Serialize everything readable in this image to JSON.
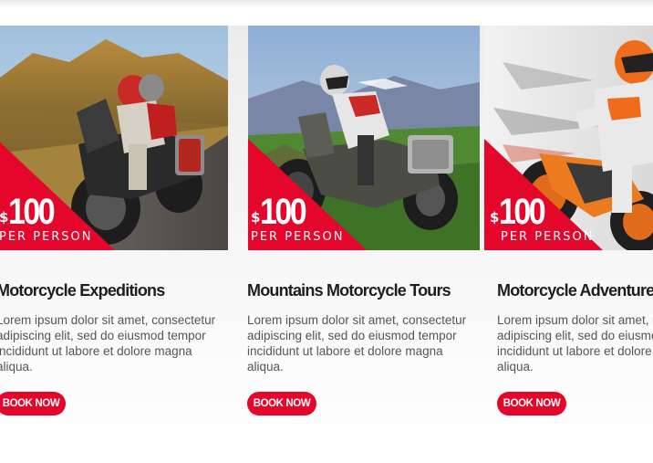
{
  "brand": {
    "accent": "#e4062b",
    "title_color": "#1e1e1e",
    "text_color": "#555555"
  },
  "tours": [
    {
      "image": "motorcycle-expedition-photo",
      "price_currency": "$",
      "price_amount": "100",
      "price_unit": "PER PERSON",
      "title": "Motorcycle Expeditions",
      "description": [
        "Lorem ipsum dolor sit amet, consectetur",
        "adipiscing elit, sed do eiusmod tempor",
        "incididunt ut labore et dolore magna",
        "aliqua."
      ],
      "button_label": "BOOK NOW"
    },
    {
      "image": "mountain-motorcycle-photo",
      "price_currency": "$",
      "price_amount": "100",
      "price_unit": "PER PERSON",
      "title": "Mountains Motorcycle Tours",
      "description": [
        "Lorem ipsum dolor sit amet, consectetur",
        "adipiscing elit, sed do eiusmod tempor",
        "incididunt ut labore et dolore magna",
        "aliqua."
      ],
      "button_label": "BOOK NOW"
    },
    {
      "image": "adventure-motorcycle-photo",
      "price_currency": "$",
      "price_amount": "100",
      "price_unit": "PER PERSON",
      "title": "Motorcycle Adventure Tours",
      "description": [
        "Lorem ipsum dolor sit amet, consectetur",
        "adipiscing elit, sed do eiusmod tempor",
        "incididunt ut labore et dolore magna",
        "aliqua."
      ],
      "button_label": "BOOK NOW"
    }
  ]
}
